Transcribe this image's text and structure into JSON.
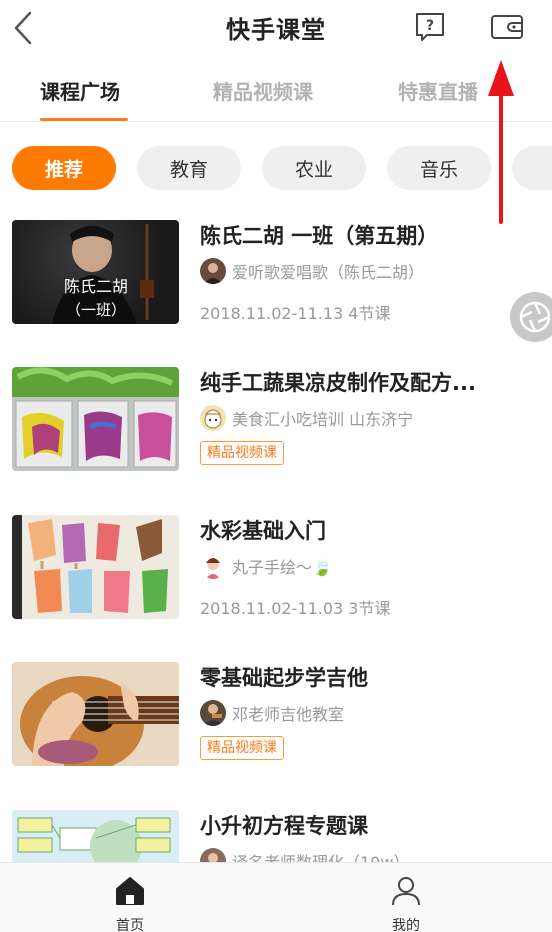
{
  "header": {
    "title": "快手课堂",
    "back_icon": "chevron-left-icon",
    "help_icon": "help-question-icon",
    "wallet_icon": "wallet-icon"
  },
  "tabs": [
    {
      "label": "课程广场",
      "active": true
    },
    {
      "label": "精品视频课",
      "active": false
    },
    {
      "label": "特惠直播",
      "active": false
    }
  ],
  "categories": [
    {
      "label": "推荐",
      "active": true
    },
    {
      "label": "教育",
      "active": false
    },
    {
      "label": "农业",
      "active": false
    },
    {
      "label": "音乐",
      "active": false
    },
    {
      "label": "",
      "active": false
    }
  ],
  "courses": [
    {
      "title": "陈氏二胡 一班（第五期）",
      "thumb_text_1": "陈氏二胡",
      "thumb_text_2": "（一班）",
      "author": "爱听歌爱唱歌（陈氏二胡）",
      "meta": "2018.11.02-11.13 4节课",
      "badge": null
    },
    {
      "title": "纯手工蔬果凉皮制作及配方...",
      "author": "美食汇小吃培训 山东济宁",
      "meta": null,
      "badge": "精品视频课"
    },
    {
      "title": "水彩基础入门",
      "author": "丸子手绘～🍃",
      "meta": "2018.11.02-11.03 3节课",
      "badge": null
    },
    {
      "title": "零基础起步学吉他",
      "author": "邓老师吉他教室",
      "meta": null,
      "badge": "精品视频课"
    },
    {
      "title": "小升初方程专题课",
      "author": "译名老师数理化（10w）",
      "meta": null,
      "badge": null
    }
  ],
  "bottom_nav": [
    {
      "label": "首页",
      "icon": "home-icon",
      "active": true
    },
    {
      "label": "我的",
      "icon": "user-icon",
      "active": false
    }
  ],
  "colors": {
    "accent": "#ff7a00",
    "annotation_arrow": "#e8141c",
    "muted_text": "#999999"
  }
}
